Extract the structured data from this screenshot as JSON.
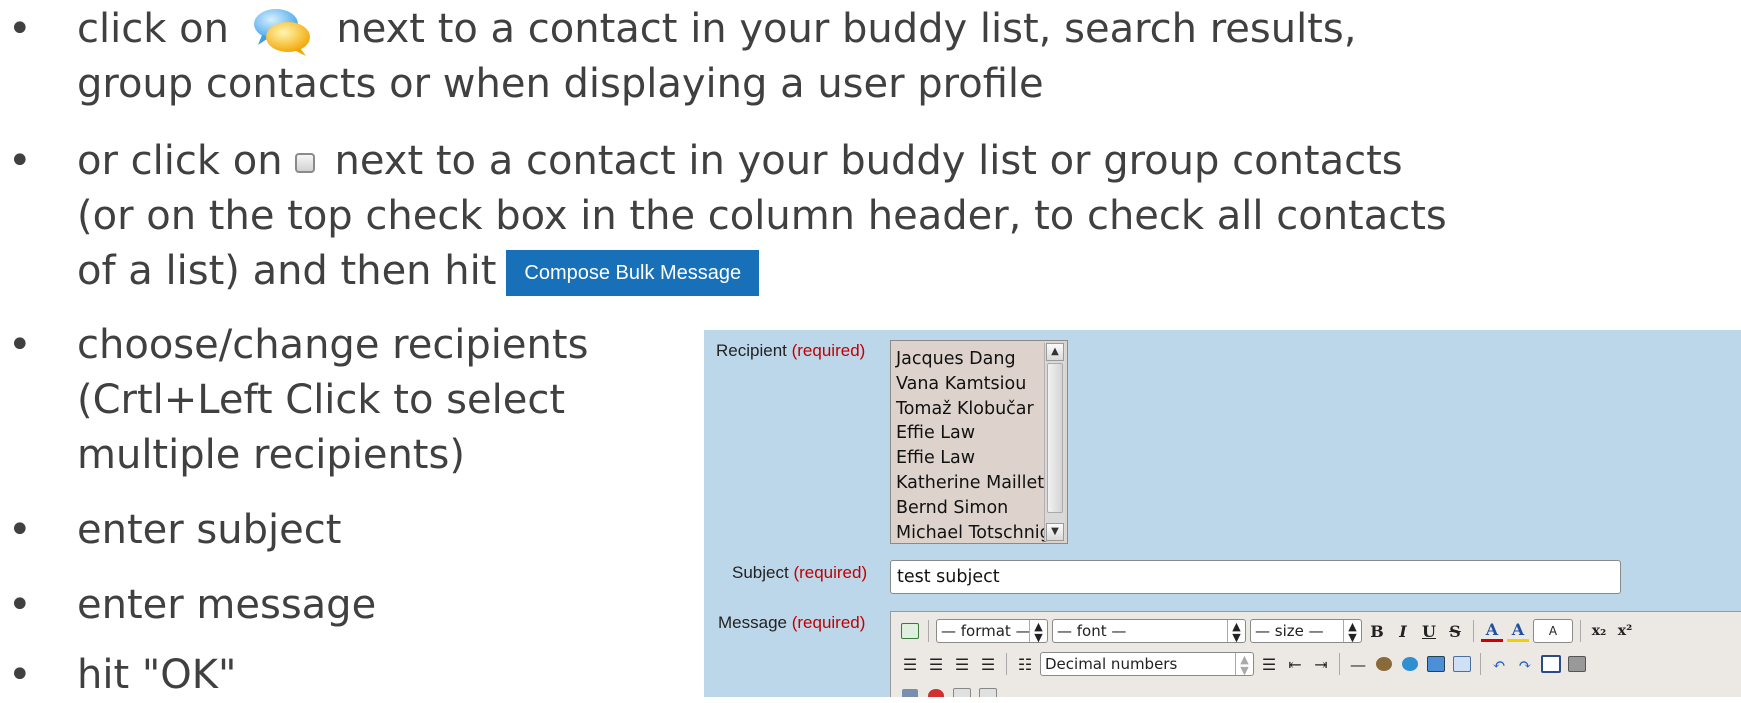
{
  "instructions": {
    "step1": {
      "before_icon": "click on",
      "icon": "chat-bubbles-icon",
      "line1_after": "next to a contact in your buddy list, search results,",
      "line2": "group contacts or when displaying a user profile"
    },
    "step2": {
      "before_icon": "or click on",
      "icon": "checkbox-icon",
      "line1_after": "next to a contact in your buddy list or group contacts",
      "line2": "(or on the top check box in the column header, to check all contacts",
      "line3_before_button": "of a list) and then hit",
      "button_label": "Compose Bulk Message"
    },
    "step3": {
      "line1": "choose/change recipients",
      "line2": "(Crtl+Left Click to select",
      "line3": "multiple recipients)"
    },
    "step4": "enter subject",
    "step5": "enter message",
    "step6": "hit \"OK\""
  },
  "form": {
    "recipient_label": "Recipient",
    "subject_label": "Subject",
    "message_label": "Message",
    "required_tag": "(required)",
    "recipients": [
      "Jacques Dang",
      "Vana Kamtsiou",
      "Tomaž Klobučar",
      "Effie Law",
      "Effie Law",
      "Katherine Maillet",
      "Bernd Simon",
      "Michael Totschnig"
    ],
    "subject_value": "test subject",
    "toolbar": {
      "format_select": "— format —",
      "font_select": "— font —",
      "size_select": "— size —",
      "bold": "B",
      "italic": "I",
      "underline": "U",
      "strikethrough": "S",
      "font_color_icon": "A",
      "bg_color_icon": "A",
      "style_box": "A",
      "subscript": "x₂",
      "superscript": "x²",
      "list_type_select": "Decimal numbers"
    }
  },
  "colors": {
    "panel_bg": "#bdd7ea",
    "button_bg": "#1770b8",
    "required_text": "#c00000"
  }
}
